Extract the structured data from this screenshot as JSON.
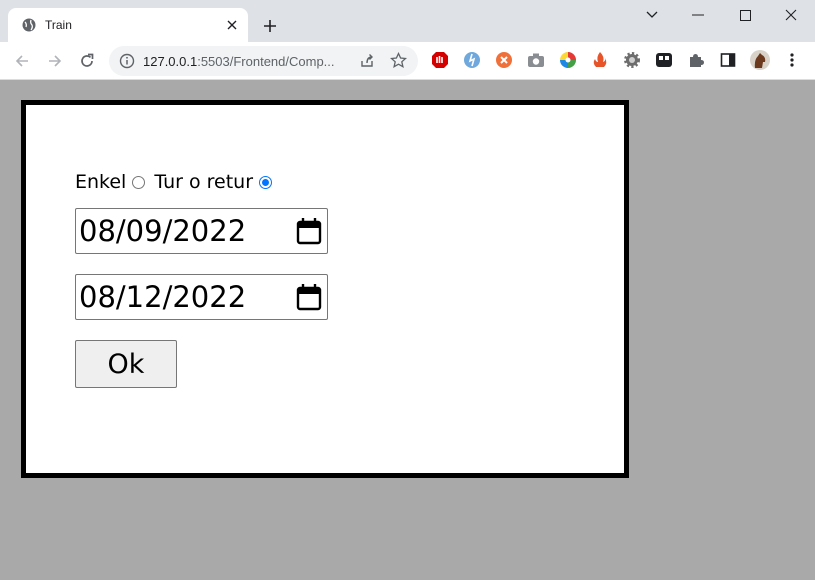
{
  "browser": {
    "tab": {
      "title": "Train",
      "favicon": "globe-icon"
    },
    "new_tab_icon": "plus-icon",
    "window_controls": [
      "chevron-down-icon",
      "minimize-icon",
      "maximize-icon",
      "close-icon"
    ],
    "address": {
      "host": "127.0.0.1",
      "rest": ":5503/Frontend/Comp..."
    },
    "extensions": [
      "ublock-icon",
      "extension-blue-icon",
      "extension-orange-icon",
      "camera-icon",
      "color-wheel-icon",
      "flame-icon",
      "gear-icon",
      "tablet-icon",
      "puzzle-icon",
      "sidepanel-icon",
      "profile-avatar"
    ]
  },
  "form": {
    "trip_type": {
      "options": [
        {
          "label": "Enkel",
          "checked": false
        },
        {
          "label": "Tur o retur",
          "checked": true
        }
      ]
    },
    "departure_date": "08/09/2022",
    "return_date": "08/12/2022",
    "ok_label": "Ok"
  },
  "colors": {
    "page_background": "#a9a9a9",
    "card_border": "#000000",
    "radio_accent": "#0075ff"
  }
}
